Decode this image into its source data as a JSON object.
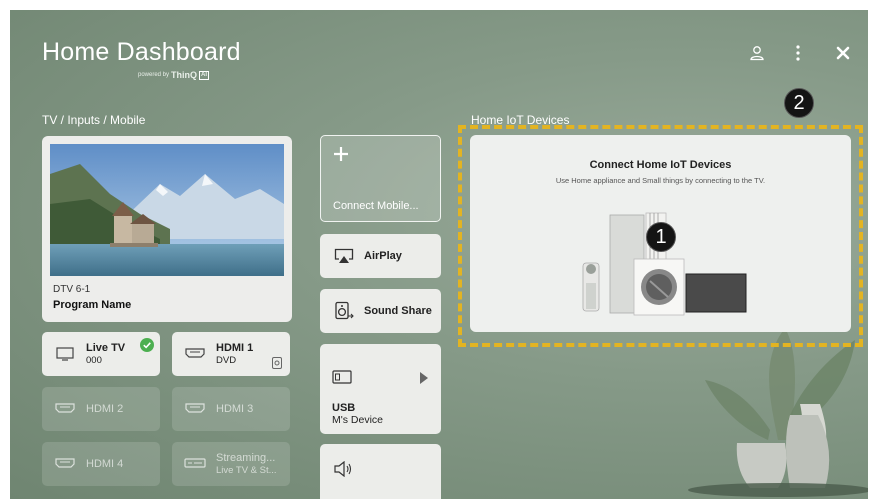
{
  "header": {
    "title": "Home Dashboard",
    "powered_prefix": "powered by",
    "powered_brand": "ThinQ",
    "powered_badge": "AI"
  },
  "sections": {
    "tv_inputs_label": "TV / Inputs / Mobile",
    "iot_label": "Home IoT Devices"
  },
  "tv_card": {
    "channel": "DTV 6-1",
    "program": "Program Name"
  },
  "inputs": [
    {
      "name": "Live TV",
      "sub": "000",
      "icon": "tv-icon",
      "active": true
    },
    {
      "name": "HDMI 1",
      "sub": "DVD",
      "icon": "hdmi-icon",
      "active": true
    },
    {
      "name": "HDMI 2",
      "sub": "",
      "icon": "hdmi-icon",
      "active": false
    },
    {
      "name": "HDMI 3",
      "sub": "",
      "icon": "hdmi-icon",
      "active": false
    },
    {
      "name": "HDMI 4",
      "sub": "",
      "icon": "hdmi-icon",
      "active": false
    },
    {
      "name": "Streaming...",
      "sub": "Live TV & St...",
      "icon": "streaming-icon",
      "active": false
    }
  ],
  "middle": {
    "connect_mobile": "Connect Mobile...",
    "airplay": "AirPlay",
    "sound_share": "Sound Share",
    "usb_title": "USB",
    "usb_device": "M's Device"
  },
  "iot": {
    "title": "Connect Home IoT Devices",
    "subtitle": "Use Home appliance and Small things by connecting to the TV."
  },
  "callouts": {
    "one": "1",
    "two": "2"
  },
  "colors": {
    "highlight_dashed": "#e3b422",
    "background": "#869a88",
    "checkmark": "#4caf50"
  }
}
